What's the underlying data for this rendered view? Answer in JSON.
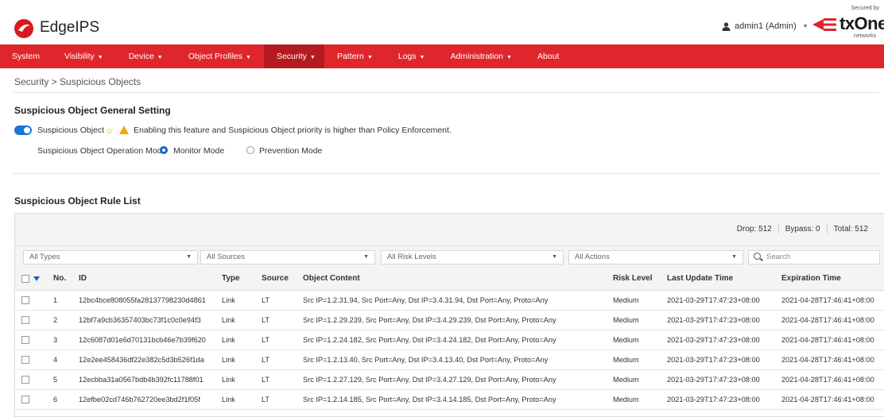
{
  "header": {
    "product_name": "EdgeIPS",
    "user": "admin1 (Admin)",
    "brand_secured": "Secured by",
    "brand_name": "txOne",
    "brand_sub": "networks"
  },
  "nav": {
    "items": [
      {
        "label": "System",
        "has_menu": false
      },
      {
        "label": "Visibility",
        "has_menu": true
      },
      {
        "label": "Device",
        "has_menu": true
      },
      {
        "label": "Object Profiles",
        "has_menu": true
      },
      {
        "label": "Security",
        "has_menu": true,
        "active": true
      },
      {
        "label": "Pattern",
        "has_menu": true
      },
      {
        "label": "Logs",
        "has_menu": true
      },
      {
        "label": "Administration",
        "has_menu": true
      },
      {
        "label": "About",
        "has_menu": false
      }
    ]
  },
  "breadcrumb": "Security > Suspicious Objects",
  "general": {
    "title": "Suspicious Object General Setting",
    "toggle_label": "Suspicious Object",
    "toggle_on": true,
    "warning": "Enabling this feature and Suspicious Object priority is higher than Policy Enforcement.",
    "mode_label": "Suspicious Object Operation Mode",
    "modes": [
      "Monitor Mode",
      "Prevention Mode"
    ],
    "selected_mode": "Monitor Mode"
  },
  "rule_list": {
    "title": "Suspicious Object Rule List",
    "drop": "Drop: 512",
    "bypass": "Bypass: 0",
    "total": "Total: 512",
    "filters": {
      "types": "All Types",
      "sources": "All Sources",
      "risk_levels": "All Risk Levels",
      "actions": "All Actions",
      "search_placeholder": "Search"
    },
    "columns": [
      "No.",
      "ID",
      "Type",
      "Source",
      "Object Content",
      "Risk Level",
      "Last Update Time",
      "Expiration Time"
    ],
    "rows": [
      {
        "no": "1",
        "id": "12bc4bce808055fa28137798230d4861",
        "type": "Link",
        "source": "LT",
        "content": "Src IP=1.2.31.94, Src Port=Any, Dst IP=3.4.31.94, Dst Port=Any, Proto=Any",
        "risk": "Medium",
        "updated": "2021-03-29T17:47:23+08:00",
        "expires": "2021-04-28T17:46:41+08:00"
      },
      {
        "no": "2",
        "id": "12bf7a9cb36357403bc73f1c0c0e94f3",
        "type": "Link",
        "source": "LT",
        "content": "Src IP=1.2.29.239, Src Port=Any, Dst IP=3.4.29.239, Dst Port=Any, Proto=Any",
        "risk": "Medium",
        "updated": "2021-03-29T17:47:23+08:00",
        "expires": "2021-04-28T17:46:41+08:00"
      },
      {
        "no": "3",
        "id": "12c6087d01e6d70131bcb46e7b39f620",
        "type": "Link",
        "source": "LT",
        "content": "Src IP=1.2.24.182, Src Port=Any, Dst IP=3.4.24.182, Dst Port=Any, Proto=Any",
        "risk": "Medium",
        "updated": "2021-03-29T17:47:23+08:00",
        "expires": "2021-04-28T17:46:41+08:00"
      },
      {
        "no": "4",
        "id": "12e2ee458436df22e382c5d3b526f1da",
        "type": "Link",
        "source": "LT",
        "content": "Src IP=1.2.13.40, Src Port=Any, Dst IP=3.4.13.40, Dst Port=Any, Proto=Any",
        "risk": "Medium",
        "updated": "2021-03-29T17:47:23+08:00",
        "expires": "2021-04-28T17:46:41+08:00"
      },
      {
        "no": "5",
        "id": "12ecbba31a0567bdb4b392fc11788f01",
        "type": "Link",
        "source": "LT",
        "content": "Src IP=1.2.27.129, Src Port=Any, Dst IP=3.4.27.129, Dst Port=Any, Proto=Any",
        "risk": "Medium",
        "updated": "2021-03-29T17:47:23+08:00",
        "expires": "2021-04-28T17:46:41+08:00"
      },
      {
        "no": "6",
        "id": "12efbe02cd746b762720ee3bd2f1f05f",
        "type": "Link",
        "source": "LT",
        "content": "Src IP=1.2.14.185, Src Port=Any, Dst IP=3.4.14.185, Dst Port=Any, Proto=Any",
        "risk": "Medium",
        "updated": "2021-03-29T17:47:23+08:00",
        "expires": "2021-04-28T17:46:41+08:00"
      }
    ]
  },
  "colors": {
    "nav_bg": "#e0262d",
    "nav_active": "#b51a20",
    "accent_blue": "#1565c0",
    "warning": "#f2a900"
  },
  "icons": {
    "logo": "trend-micro-logo-icon",
    "user": "user-icon",
    "bulb": "lightbulb-icon",
    "warning": "warning-icon",
    "search": "search-icon"
  }
}
